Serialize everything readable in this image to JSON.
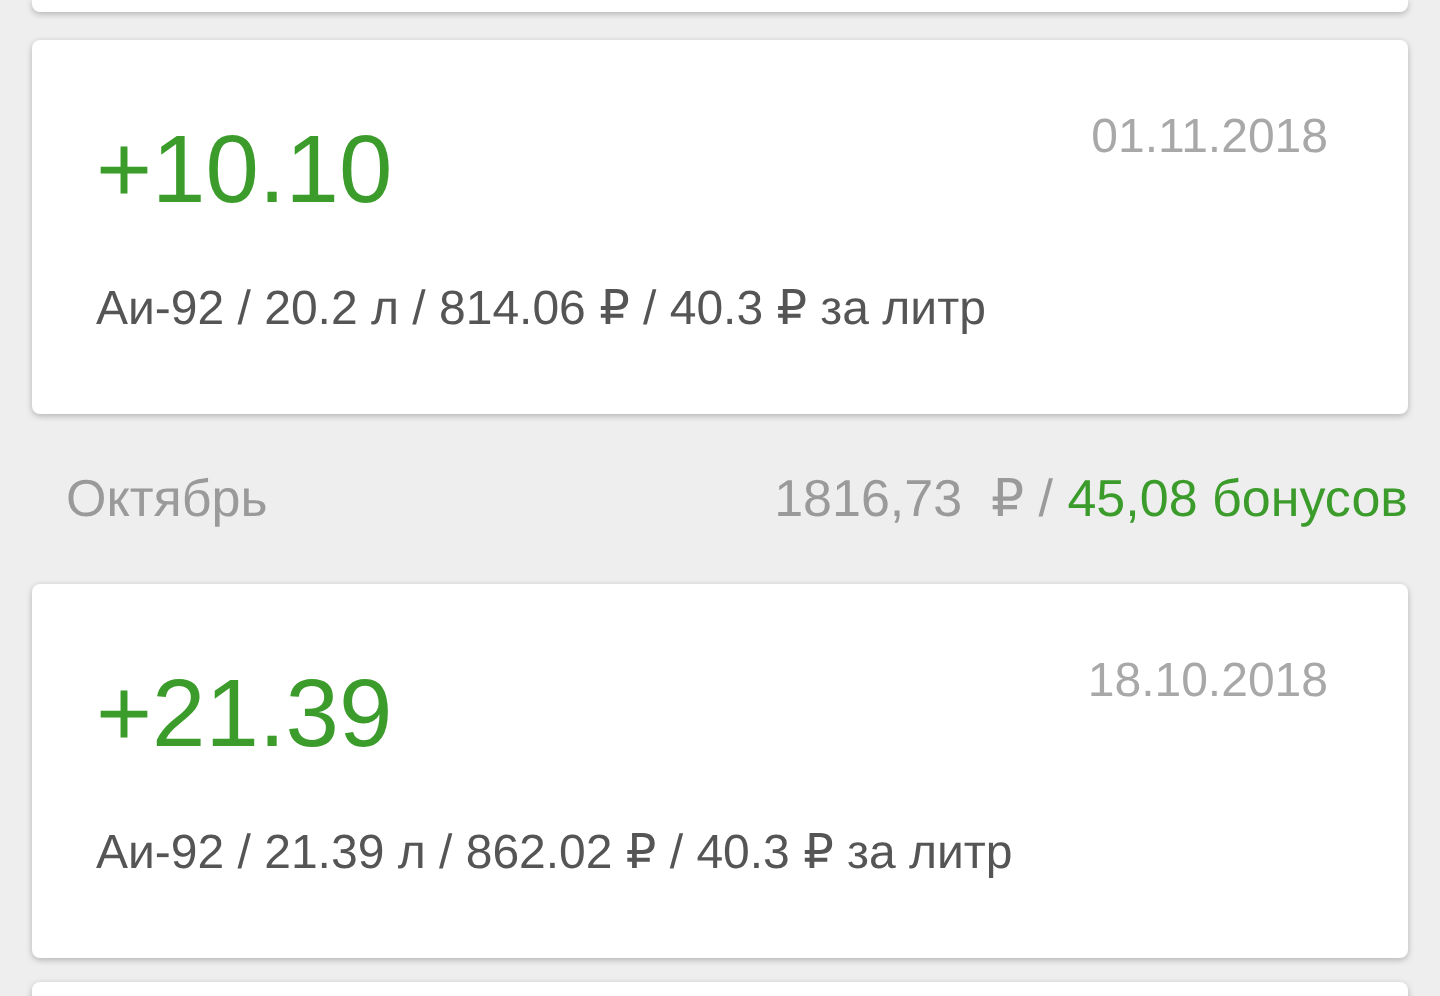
{
  "items": [
    {
      "kind": "transaction",
      "amount": "+10.10",
      "date": "01.11.2018",
      "details": "Аи-92 / 20.2 л / 814.06 ₽ / 40.3 ₽ за литр"
    },
    {
      "kind": "month",
      "name": "Октябрь",
      "total": "1816,73  ₽ / ",
      "bonus": "45,08 бонусов"
    },
    {
      "kind": "transaction",
      "amount": "+21.39",
      "date": "18.10.2018",
      "details": "Аи-92 / 21.39 л / 862.02 ₽ / 40.3 ₽ за литр"
    }
  ]
}
